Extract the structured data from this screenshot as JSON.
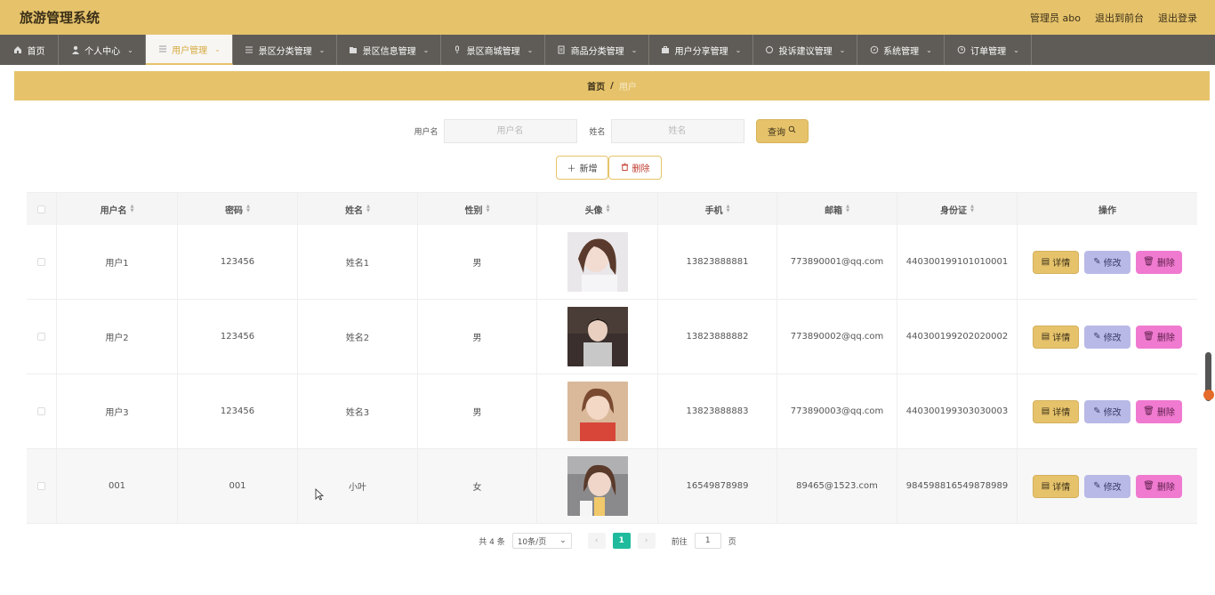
{
  "header": {
    "title": "旅游管理系统",
    "admin": "管理员 abo",
    "to_front": "退出到前台",
    "logout": "退出登录"
  },
  "nav": [
    {
      "label": "首页",
      "icon": "home-icon"
    },
    {
      "label": "个人中心",
      "icon": "user-icon"
    },
    {
      "label": "用户管理",
      "icon": "list-icon",
      "active": true
    },
    {
      "label": "景区分类管理",
      "icon": "menu-icon"
    },
    {
      "label": "景区信息管理",
      "icon": "folder-icon"
    },
    {
      "label": "景区商城管理",
      "icon": "mic-icon"
    },
    {
      "label": "商品分类管理",
      "icon": "doc-icon"
    },
    {
      "label": "用户分享管理",
      "icon": "briefcase-icon"
    },
    {
      "label": "投诉建议管理",
      "icon": "refresh-icon"
    },
    {
      "label": "系统管理",
      "icon": "compass-icon"
    },
    {
      "label": "订单管理",
      "icon": "clock-icon"
    }
  ],
  "breadcrumb": {
    "home": "首页",
    "sep": "/",
    "current": "用户"
  },
  "search": {
    "username_label": "用户名",
    "username_placeholder": "用户名",
    "name_label": "姓名",
    "name_placeholder": "姓名",
    "query_button": "查询"
  },
  "ops": {
    "add": "新增",
    "delete": "删除"
  },
  "table": {
    "headers": [
      "用户名",
      "密码",
      "姓名",
      "性别",
      "头像",
      "手机",
      "邮箱",
      "身份证",
      "操作"
    ],
    "rows": [
      {
        "username": "用户1",
        "password": "123456",
        "name": "姓名1",
        "gender": "男",
        "phone": "13823888881",
        "email": "773890001@qq.com",
        "id_card": "440300199101010001"
      },
      {
        "username": "用户2",
        "password": "123456",
        "name": "姓名2",
        "gender": "男",
        "phone": "13823888882",
        "email": "773890002@qq.com",
        "id_card": "440300199202020002"
      },
      {
        "username": "用户3",
        "password": "123456",
        "name": "姓名3",
        "gender": "男",
        "phone": "13823888883",
        "email": "773890003@qq.com",
        "id_card": "440300199303030003"
      },
      {
        "username": "001",
        "password": "001",
        "name": "小叶",
        "gender": "女",
        "phone": "16549878989",
        "email": "89465@1523.com",
        "id_card": "984598816549878989"
      }
    ],
    "actions": {
      "detail": "详情",
      "edit": "修改",
      "delete": "删除"
    }
  },
  "pager": {
    "total": "共 4 条",
    "page_size": "10条/页",
    "current_page": "1",
    "goto_label": "前往",
    "goto_value": "1",
    "page_unit": "页"
  },
  "colors": {
    "accent": "#e6c36b",
    "nav_bg": "#5f5c57",
    "edit": "#b8b9e6",
    "delete": "#f07ad0",
    "pager_current": "#1fbb9c"
  }
}
